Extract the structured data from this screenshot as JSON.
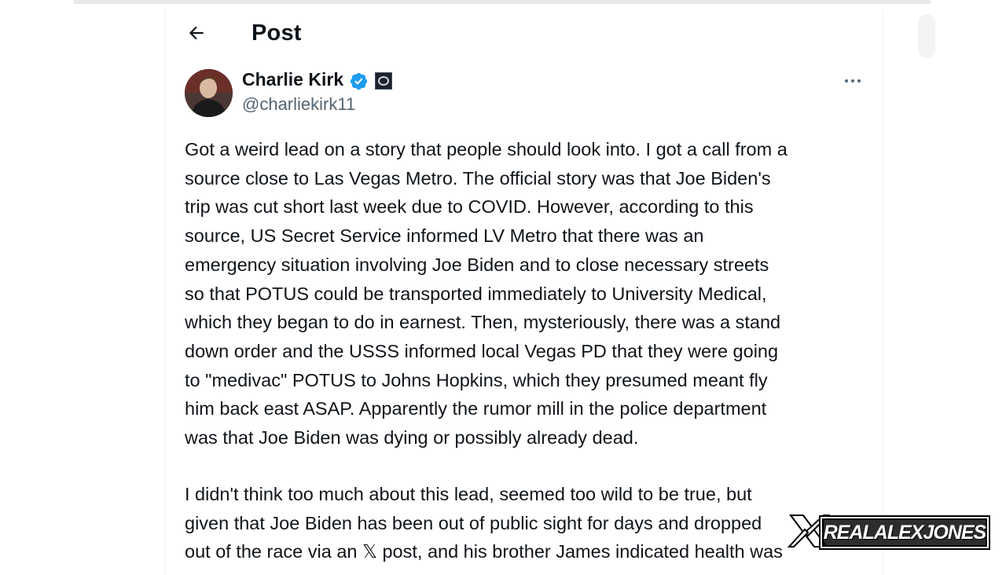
{
  "header": {
    "title": "Post"
  },
  "post": {
    "author_name": "Charlie Kirk",
    "author_handle": "@charliekirk11",
    "paragraph_1": "Got a weird lead on a story that people should look into. I got a call from a\nsource close to Las Vegas Metro. The official story was that Joe Biden's\ntrip was cut short last week due to COVID. However, according to this\nsource, US Secret Service informed LV Metro that there was an\nemergency situation involving Joe Biden and to close necessary streets\nso that POTUS could be transported immediately to University Medical,\nwhich they began to do in earnest. Then, mysteriously, there was a stand\ndown order and the USSS informed local Vegas PD that they were going\nto \"medivac\" POTUS to Johns Hopkins, which they presumed meant fly\nhim back east ASAP. Apparently the rumor mill in the police department\nwas that Joe Biden was dying or possibly already dead.",
    "paragraph_2": "I didn't think too much about this lead, seemed too wild to be true, but\ngiven that Joe Biden has been out of public sight for days and dropped\nout of the race via an 𝕏 post, and his brother James indicated health was"
  },
  "watermark": {
    "text": "REALALEXJONES"
  },
  "icons": {
    "back": "arrow-left-icon",
    "verified": "verified-badge-icon",
    "more": "more-horizontal-icon"
  },
  "colors": {
    "verified_blue": "#1d9bf0",
    "secondary_text": "#536471",
    "primary_text": "#0f1419"
  }
}
